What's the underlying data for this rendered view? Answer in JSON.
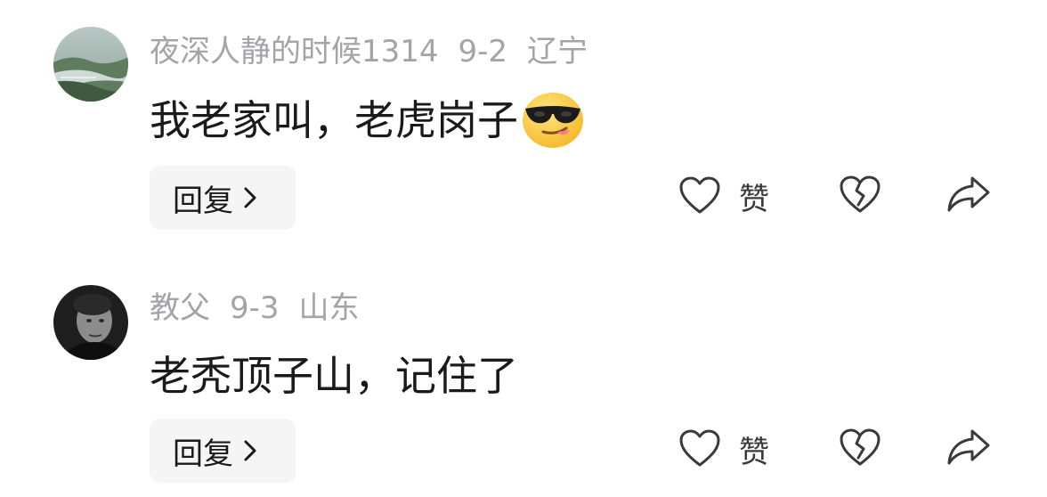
{
  "comments": [
    {
      "username": "夜深人静的时候1314",
      "date": "9-2",
      "location": "辽宁",
      "text": "我老家叫，老虎岗子",
      "emoji": "cool-sunglasses-emoji",
      "reply_label": "回复",
      "like_label": "赞",
      "avatar": "landscape-avatar"
    },
    {
      "username": "教父",
      "date": "9-3",
      "location": "山东",
      "text": "老秃顶子山，记住了",
      "emoji": null,
      "reply_label": "回复",
      "like_label": "赞",
      "avatar": "portrait-avatar"
    }
  ],
  "icons": {
    "reply_chevron": "chevron-right-icon",
    "like": "heart-outline-icon",
    "dislike": "broken-heart-icon",
    "share": "share-arrow-icon"
  },
  "colors": {
    "meta_text": "#a3a3a8",
    "content_text": "#1a1a1a",
    "reply_bg": "#f5f5f5",
    "icon_stroke": "#3a3a3a"
  }
}
